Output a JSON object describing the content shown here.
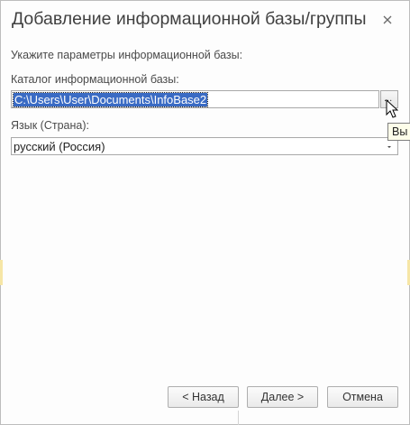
{
  "dialog": {
    "title": "Добавление информационной базы/группы",
    "close_icon": "close-icon"
  },
  "form": {
    "heading": "Укажите параметры информационной базы:",
    "catalog_label": "Каталог информационной базы:",
    "catalog_value": "C:\\Users\\User\\Documents\\InfoBase2",
    "browse_label": "...",
    "language_label": "Язык (Страна):",
    "language_value": "русский (Россия)",
    "tooltip": "Вы"
  },
  "buttons": {
    "back": "< Назад",
    "next": "Далее >",
    "cancel": "Отмена"
  },
  "colors": {
    "selection": "#3a6bc4",
    "tooltip_bg": "#fdfde9",
    "title_text": "#404040"
  }
}
